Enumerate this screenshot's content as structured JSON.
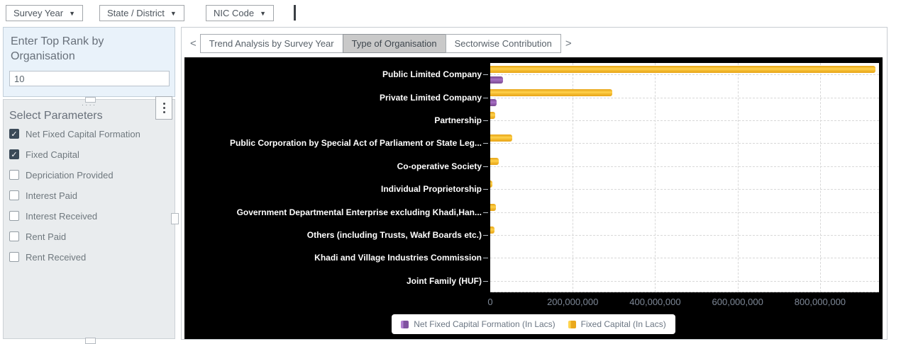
{
  "topbar": {
    "filters": [
      {
        "label": "Survey Year"
      },
      {
        "label": "State / District"
      },
      {
        "label": "NIC Code"
      }
    ]
  },
  "sidebar": {
    "rank_panel": {
      "title": "Enter Top Rank by Organisation",
      "input_value": "10"
    },
    "params_panel": {
      "title": "Select Parameters",
      "items": [
        {
          "label": "Net Fixed Capital Formation",
          "checked": true
        },
        {
          "label": "Fixed Capital",
          "checked": true
        },
        {
          "label": "Depriciation Provided",
          "checked": false
        },
        {
          "label": "Interest Paid",
          "checked": false
        },
        {
          "label": "Interest Received",
          "checked": false
        },
        {
          "label": "Rent Paid",
          "checked": false
        },
        {
          "label": "Rent Received",
          "checked": false
        }
      ]
    }
  },
  "main": {
    "prev_arrow": "<",
    "next_arrow": ">",
    "tabs": [
      {
        "label": "Trend Analysis by Survey Year",
        "active": false
      },
      {
        "label": "Type of Organisation",
        "active": true
      },
      {
        "label": "Sectorwise Contribution",
        "active": false
      }
    ]
  },
  "chart_data": {
    "type": "bar",
    "orientation": "horizontal",
    "background": "#000000",
    "categories": [
      "Public Limited Company",
      "Private Limited Company",
      "Partnership",
      "Public Corporation by Special Act of Parliament or State Leg...",
      "Co-operative Society",
      "Individual Proprietorship",
      "Government Departmental Enterprise excluding Khadi,Han...",
      "Others (including Trusts, Wakf  Boards etc.)",
      "Khadi and Village Industries Commission",
      "Joint Family (HUF)"
    ],
    "series": [
      {
        "name": "Net Fixed Capital Formation  (In Lacs)",
        "color": "#8e5ca8",
        "values": [
          31000000,
          15000000,
          0,
          0,
          0,
          0,
          0,
          0,
          0,
          0
        ]
      },
      {
        "name": "Fixed Capital  (In Lacs)",
        "color": "#fdc32d",
        "values": [
          934000000,
          296000000,
          12000000,
          53000000,
          20000000,
          5000000,
          14000000,
          10000000,
          0,
          0
        ]
      }
    ],
    "group_order_top_to_bottom": [
      "Fixed Capital  (In Lacs)",
      "Net Fixed Capital Formation  (In Lacs)"
    ],
    "xlim": [
      0,
      943000000
    ],
    "xticks": [
      0,
      200000000,
      400000000,
      600000000,
      800000000
    ],
    "xtick_labels": [
      "0",
      "200,000,000",
      "400,000,000",
      "600,000,000",
      "800,000,000"
    ],
    "grid": "dashed",
    "legend_position": "bottom-center"
  }
}
